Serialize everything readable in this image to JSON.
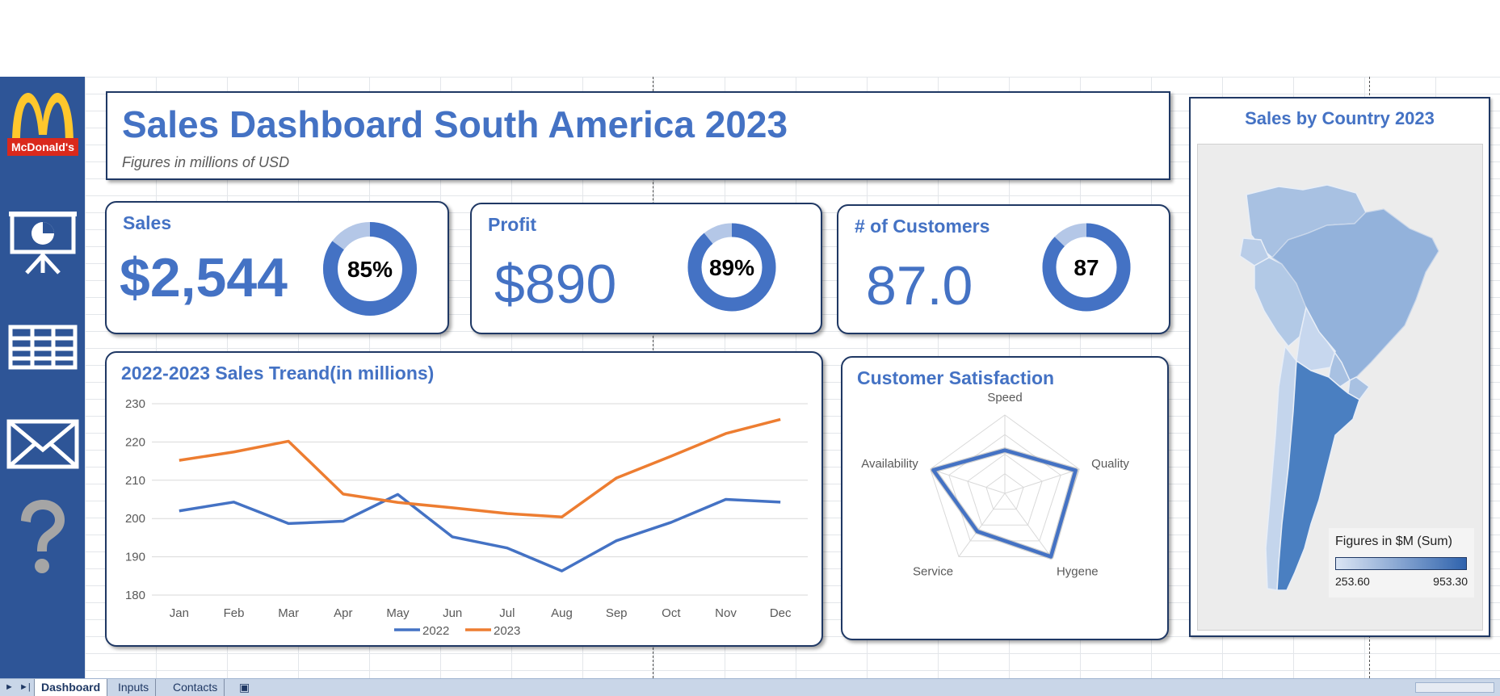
{
  "title": "Sales Dashboard South America 2023",
  "subtitle": "Figures in millions of USD",
  "rail": {
    "logo_text": "McDonald's",
    "buttons": [
      "presentation-icon",
      "table-icon",
      "mail-icon",
      "question-icon"
    ]
  },
  "kpis": {
    "sales": {
      "label": "Sales",
      "value": "$2,544",
      "pct_text": "85%",
      "pct": 0.85
    },
    "profit": {
      "label": "Profit",
      "value": "$890",
      "pct_text": "89%",
      "pct": 0.89
    },
    "customers": {
      "label": "# of Customers",
      "value": "87.0",
      "pct_text": "87",
      "pct": 0.87
    }
  },
  "trend": {
    "title": "2022-2023 Sales Treand(in millions)",
    "chart_data": {
      "type": "line",
      "categories": [
        "Jan",
        "Feb",
        "Mar",
        "Apr",
        "May",
        "Jun",
        "Jul",
        "Aug",
        "Sep",
        "Oct",
        "Nov",
        "Dec"
      ],
      "series": [
        {
          "name": "2022",
          "color": "#4472c4",
          "values": [
            202,
            204.3,
            198.7,
            199.3,
            206.3,
            195.2,
            192.3,
            186.3,
            194.2,
            199,
            205,
            204.3
          ]
        },
        {
          "name": "2023",
          "color": "#ed7d31",
          "values": [
            215.2,
            217.4,
            220.2,
            206.4,
            204.2,
            202.8,
            201.3,
            200.4,
            210.6,
            216.3,
            222.2,
            225.9
          ]
        }
      ],
      "ylim": [
        180,
        230
      ],
      "yticks": [
        180,
        190,
        200,
        210,
        220,
        230
      ],
      "grid": true,
      "legend": "bottom"
    }
  },
  "satisfaction": {
    "title": "Customer Satisfaction",
    "chart_data": {
      "type": "radar",
      "axes": [
        "Speed",
        "Quality",
        "Hygene",
        "Service",
        "Availability"
      ],
      "values": [
        0.55,
        0.95,
        1.0,
        0.6,
        0.96
      ],
      "rmax": 1,
      "color": "#4472c4"
    }
  },
  "map": {
    "title": "Sales by Country 2023",
    "legend_title": "Figures in $M (Sum)",
    "legend_min": "253.60",
    "legend_max": "953.30"
  },
  "tabs": {
    "active": "Dashboard",
    "items": [
      "Dashboard",
      "Inputs",
      "Contacts"
    ]
  }
}
